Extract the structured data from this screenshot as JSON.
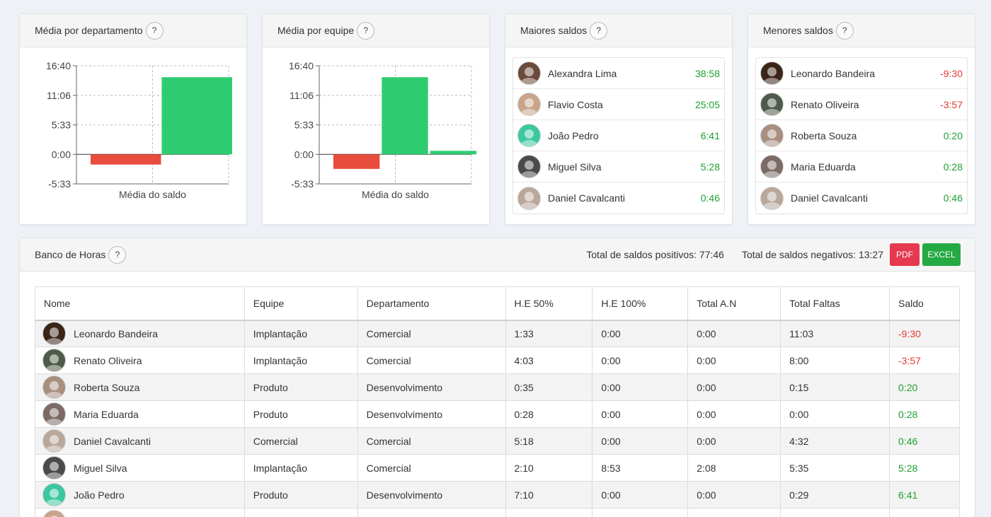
{
  "colors": {
    "positive": "#1fa033",
    "negative": "#e53935",
    "bar_positive": "#2ecc71",
    "bar_negative": "#e74c3c"
  },
  "cards": {
    "dept": {
      "title": "Média por departamento",
      "help": "?",
      "chart_data": {
        "type": "bar",
        "xlabel": "Média do saldo",
        "yticks": [
          "16:40",
          "11:06",
          "5:33",
          "0:00",
          "-5:33"
        ],
        "ylim_minutes": [
          -333,
          1000
        ],
        "series_minutes": [
          -115,
          871
        ]
      }
    },
    "team": {
      "title": "Média por equipe",
      "help": "?",
      "chart_data": {
        "type": "bar",
        "xlabel": "Média do saldo",
        "yticks": [
          "16:40",
          "11:06",
          "5:33",
          "0:00",
          "-5:33"
        ],
        "ylim_minutes": [
          -333,
          1000
        ],
        "series_minutes": [
          -164,
          871,
          40
        ]
      }
    },
    "top": {
      "title": "Maiores saldos",
      "help": "?",
      "items": [
        {
          "name": "Alexandra Lima",
          "value": "38:58",
          "sign": "pos",
          "avatar": "#6b4a3a"
        },
        {
          "name": "Flavio Costa",
          "value": "25:05",
          "sign": "pos",
          "avatar": "#c9a48a"
        },
        {
          "name": "João Pedro",
          "value": "6:41",
          "sign": "pos",
          "avatar": "#3cc7a0"
        },
        {
          "name": "Miguel Silva",
          "value": "5:28",
          "sign": "pos",
          "avatar": "#4a4a4a"
        },
        {
          "name": "Daniel Cavalcanti",
          "value": "0:46",
          "sign": "pos",
          "avatar": "#b9a79a"
        }
      ]
    },
    "bottom": {
      "title": "Menores saldos",
      "help": "?",
      "items": [
        {
          "name": "Leonardo Bandeira",
          "value": "-9:30",
          "sign": "neg",
          "avatar": "#3b2418"
        },
        {
          "name": "Renato Oliveira",
          "value": "-3:57",
          "sign": "neg",
          "avatar": "#4e5b4a"
        },
        {
          "name": "Roberta Souza",
          "value": "0:20",
          "sign": "pos",
          "avatar": "#a88f80"
        },
        {
          "name": "Maria Eduarda",
          "value": "0:28",
          "sign": "pos",
          "avatar": "#7c6a64"
        },
        {
          "name": "Daniel Cavalcanti",
          "value": "0:46",
          "sign": "pos",
          "avatar": "#b9a79a"
        }
      ]
    }
  },
  "banco": {
    "title": "Banco de Horas",
    "help": "?",
    "total_pos": "Total de saldos positivos: 77:46",
    "total_neg": "Total de saldos negativos: 13:27",
    "pdf_label": "PDF",
    "excel_label": "EXCEL",
    "columns": [
      "Nome",
      "Equipe",
      "Departamento",
      "H.E 50%",
      "H.E 100%",
      "Total A.N",
      "Total Faltas",
      "Saldo"
    ],
    "rows": [
      {
        "name": "Leonardo Bandeira",
        "team": "Implantação",
        "dept": "Comercial",
        "he50": "1:33",
        "he100": "0:00",
        "an": "0:00",
        "faltas": "11:03",
        "saldo": "-9:30",
        "sign": "neg",
        "avatar": "#3b2418"
      },
      {
        "name": "Renato Oliveira",
        "team": "Implantação",
        "dept": "Comercial",
        "he50": "4:03",
        "he100": "0:00",
        "an": "0:00",
        "faltas": "8:00",
        "saldo": "-3:57",
        "sign": "neg",
        "avatar": "#4e5b4a"
      },
      {
        "name": "Roberta Souza",
        "team": "Produto",
        "dept": "Desenvolvimento",
        "he50": "0:35",
        "he100": "0:00",
        "an": "0:00",
        "faltas": "0:15",
        "saldo": "0:20",
        "sign": "pos",
        "avatar": "#a88f80"
      },
      {
        "name": "Maria Eduarda",
        "team": "Produto",
        "dept": "Desenvolvimento",
        "he50": "0:28",
        "he100": "0:00",
        "an": "0:00",
        "faltas": "0:00",
        "saldo": "0:28",
        "sign": "pos",
        "avatar": "#7c6a64"
      },
      {
        "name": "Daniel Cavalcanti",
        "team": "Comercial",
        "dept": "Comercial",
        "he50": "5:18",
        "he100": "0:00",
        "an": "0:00",
        "faltas": "4:32",
        "saldo": "0:46",
        "sign": "pos",
        "avatar": "#b9a79a"
      },
      {
        "name": "Miguel Silva",
        "team": "Implantação",
        "dept": "Comercial",
        "he50": "2:10",
        "he100": "8:53",
        "an": "2:08",
        "faltas": "5:35",
        "saldo": "5:28",
        "sign": "pos",
        "avatar": "#4a4a4a"
      },
      {
        "name": "João Pedro",
        "team": "Produto",
        "dept": "Desenvolvimento",
        "he50": "7:10",
        "he100": "0:00",
        "an": "0:00",
        "faltas": "0:29",
        "saldo": "6:41",
        "sign": "pos",
        "avatar": "#3cc7a0"
      },
      {
        "name": "",
        "team": "",
        "dept": "",
        "he50": "",
        "he100": "",
        "an": "",
        "faltas": "",
        "saldo": "",
        "sign": "pos",
        "avatar": "#c9a48a"
      }
    ]
  }
}
